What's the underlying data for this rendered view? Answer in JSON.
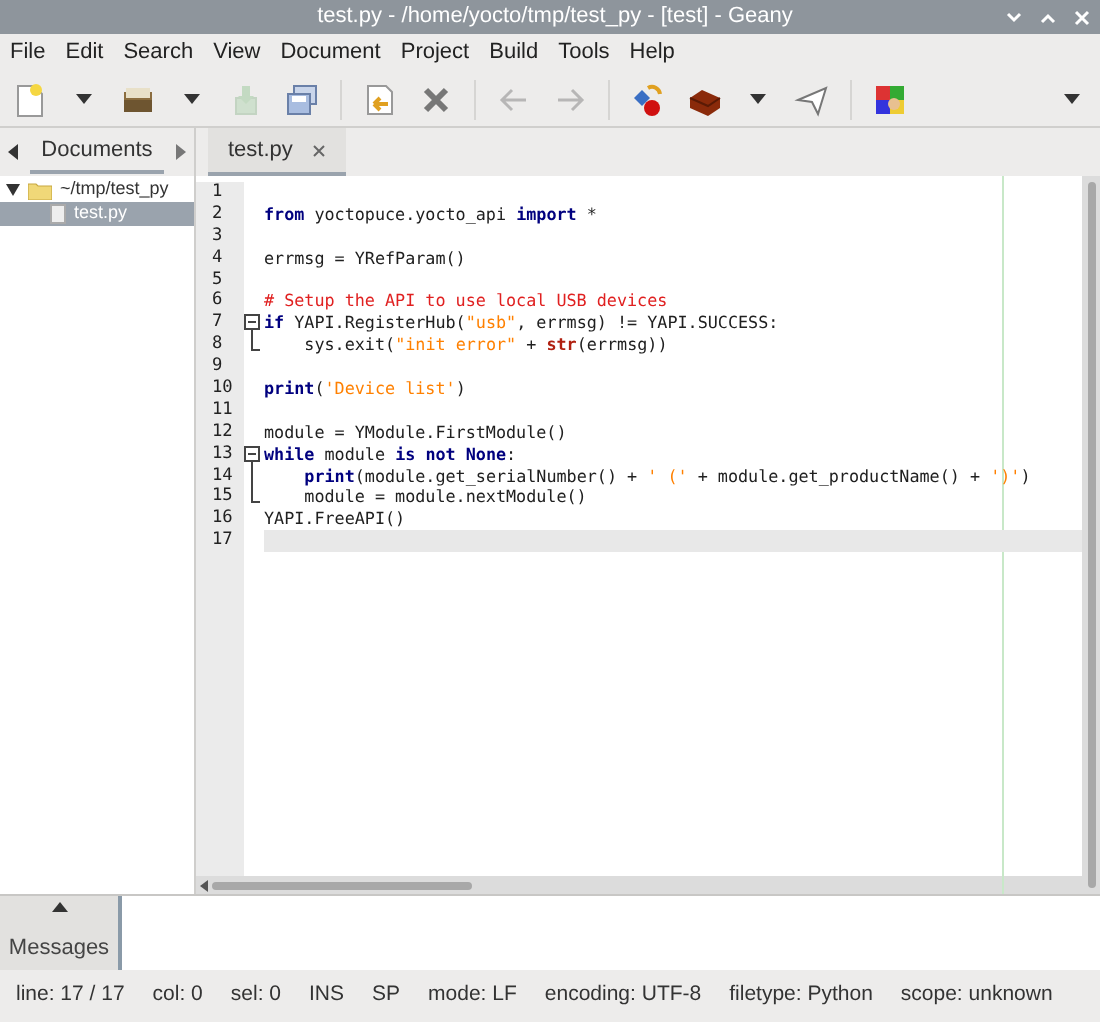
{
  "window": {
    "title": "test.py - /home/yocto/tmp/test_py - [test] - Geany"
  },
  "menu": [
    "File",
    "Edit",
    "Search",
    "View",
    "Document",
    "Project",
    "Build",
    "Tools",
    "Help"
  ],
  "toolbar": [
    {
      "kind": "new",
      "disabled": false
    },
    {
      "kind": "caret",
      "disabled": false
    },
    {
      "kind": "open",
      "disabled": false
    },
    {
      "kind": "caret",
      "disabled": false
    },
    {
      "kind": "save",
      "disabled": true
    },
    {
      "kind": "saveall",
      "disabled": false
    },
    {
      "kind": "sep"
    },
    {
      "kind": "reload",
      "disabled": false
    },
    {
      "kind": "close",
      "disabled": false
    },
    {
      "kind": "sep"
    },
    {
      "kind": "back",
      "disabled": true
    },
    {
      "kind": "forward",
      "disabled": true
    },
    {
      "kind": "sep"
    },
    {
      "kind": "compile",
      "disabled": false
    },
    {
      "kind": "build",
      "disabled": false
    },
    {
      "kind": "caret",
      "disabled": false
    },
    {
      "kind": "run",
      "disabled": false
    },
    {
      "kind": "sep"
    },
    {
      "kind": "color",
      "disabled": false
    }
  ],
  "sidebar": {
    "tab": "Documents",
    "tree": [
      {
        "label": "~/tmp/test_py",
        "expanded": true,
        "selected": false,
        "children": [
          {
            "label": "test.py",
            "selected": true
          }
        ]
      }
    ]
  },
  "editor": {
    "tabs": [
      {
        "label": "test.py",
        "selected": true
      }
    ],
    "lines": [
      {
        "number": "1"
      },
      {
        "number": "2",
        "tokens": [
          {
            "kind": "kw",
            "text": "from"
          },
          {
            "kind": "t",
            "text": " yoctopuce.yocto_api "
          },
          {
            "kind": "kw",
            "text": "import"
          },
          {
            "kind": "t",
            "text": " *"
          }
        ]
      },
      {
        "number": "3"
      },
      {
        "number": "4",
        "tokens": [
          {
            "kind": "t",
            "text": "errmsg = YRefParam()"
          }
        ]
      },
      {
        "number": "5"
      },
      {
        "number": "6",
        "tokens": [
          {
            "kind": "com",
            "text": "# Setup the API to use local USB devices"
          }
        ]
      },
      {
        "number": "7",
        "fold": {
          "kind": "start"
        },
        "tokens": [
          {
            "kind": "kw",
            "text": "if"
          },
          {
            "kind": "t",
            "text": " YAPI.RegisterHub("
          },
          {
            "kind": "str",
            "text": "\"usb\""
          },
          {
            "kind": "t",
            "text": ", errmsg) != YAPI.SUCCESS:"
          }
        ]
      },
      {
        "number": "8",
        "fold": {
          "kind": "end"
        },
        "tokens": [
          {
            "kind": "t",
            "text": "    sys.exit("
          },
          {
            "kind": "str",
            "text": "\"init error\""
          },
          {
            "kind": "t",
            "text": " + "
          },
          {
            "kind": "fn",
            "text": "str"
          },
          {
            "kind": "t",
            "text": "(errmsg))"
          }
        ]
      },
      {
        "number": "9"
      },
      {
        "number": "10",
        "tokens": [
          {
            "kind": "kw",
            "text": "print"
          },
          {
            "kind": "t",
            "text": "("
          },
          {
            "kind": "str",
            "text": "'Device list'"
          },
          {
            "kind": "t",
            "text": ")"
          }
        ]
      },
      {
        "number": "11"
      },
      {
        "number": "12",
        "tokens": [
          {
            "kind": "t",
            "text": "module = YModule.FirstModule()"
          }
        ]
      },
      {
        "number": "13",
        "fold": {
          "kind": "start"
        },
        "tokens": [
          {
            "kind": "kw",
            "text": "while"
          },
          {
            "kind": "t",
            "text": " module "
          },
          {
            "kind": "kw",
            "text": "is not None"
          },
          {
            "kind": "t",
            "text": ":"
          }
        ]
      },
      {
        "number": "14",
        "fold": {
          "kind": "body"
        },
        "tokens": [
          {
            "kind": "kw",
            "text": "    print"
          },
          {
            "kind": "t",
            "text": "(module.get_serialNumber() + "
          },
          {
            "kind": "str",
            "text": "' ('"
          },
          {
            "kind": "t",
            "text": " + module.get_productName() + "
          },
          {
            "kind": "str",
            "text": "')'"
          },
          {
            "kind": "t",
            "text": ")"
          }
        ]
      },
      {
        "number": "15",
        "fold": {
          "kind": "end"
        },
        "tokens": [
          {
            "kind": "t",
            "text": "    module = module.nextModule()"
          }
        ]
      },
      {
        "number": "16",
        "tokens": [
          {
            "kind": "t",
            "text": "YAPI.FreeAPI()"
          }
        ]
      },
      {
        "number": "17",
        "current": true
      }
    ]
  },
  "messages": {
    "tab": "Messages"
  },
  "status_bar": [
    "line: 17 / 17",
    "col: 0",
    "sel: 0",
    "INS",
    "SP",
    "mode: LF",
    "encoding: UTF-8",
    "filetype: Python",
    "scope: unknown"
  ]
}
